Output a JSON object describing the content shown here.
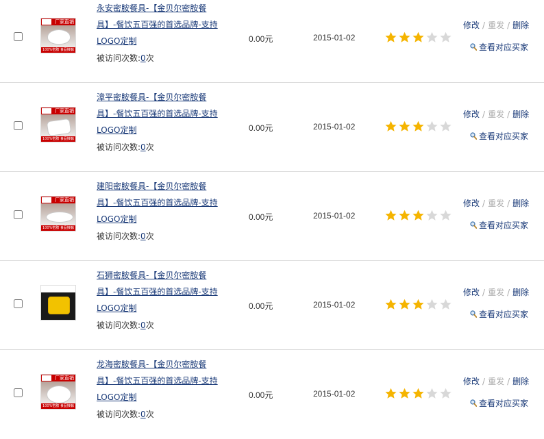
{
  "rows": [
    {
      "title": "永安密胺餐具-【金贝尔密胺餐具】-餐饮五百强的首选品牌-支持LOGO定制",
      "visits_label": "被访问次数:",
      "visits_count": "0",
      "visits_unit": "次",
      "price": "0.00元",
      "date": "2015-01-02",
      "rating": 3,
      "rating_max": 5,
      "thumb_banner": "厂家直销",
      "thumb_footer": "100%密胺 食品接触",
      "edit_label": "修改",
      "resend_label": "重发",
      "delete_label": "删除",
      "buyers_label": "查看对应买家"
    },
    {
      "title": "漳平密胺餐具-【金贝尔密胺餐具】-餐饮五百强的首选品牌-支持LOGO定制",
      "visits_label": "被访问次数:",
      "visits_count": "0",
      "visits_unit": "次",
      "price": "0.00元",
      "date": "2015-01-02",
      "rating": 3,
      "rating_max": 5,
      "thumb_banner": "厂家直销",
      "thumb_footer": "100%密胺 食品接触",
      "edit_label": "修改",
      "resend_label": "重发",
      "delete_label": "删除",
      "buyers_label": "查看对应买家"
    },
    {
      "title": "建阳密胺餐具-【金贝尔密胺餐具】-餐饮五百强的首选品牌-支持LOGO定制",
      "visits_label": "被访问次数:",
      "visits_count": "0",
      "visits_unit": "次",
      "price": "0.00元",
      "date": "2015-01-02",
      "rating": 3,
      "rating_max": 5,
      "thumb_banner": "厂家直销",
      "thumb_footer": "100%密胺 食品接触",
      "edit_label": "修改",
      "resend_label": "重发",
      "delete_label": "删除",
      "buyers_label": "查看对应买家"
    },
    {
      "title": "石狮密胺餐具-【金贝尔密胺餐具】-餐饮五百强的首选品牌-支持LOGO定制",
      "visits_label": "被访问次数:",
      "visits_count": "0",
      "visits_unit": "次",
      "price": "0.00元",
      "date": "2015-01-02",
      "rating": 3,
      "rating_max": 5,
      "thumb_banner": "",
      "thumb_footer": "",
      "edit_label": "修改",
      "resend_label": "重发",
      "delete_label": "删除",
      "buyers_label": "查看对应买家"
    },
    {
      "title": "龙海密胺餐具-【金贝尔密胺餐具】-餐饮五百强的首选品牌-支持LOGO定制",
      "visits_label": "被访问次数:",
      "visits_count": "0",
      "visits_unit": "次",
      "price": "0.00元",
      "date": "2015-01-02",
      "rating": 3,
      "rating_max": 5,
      "thumb_banner": "厂家直销",
      "thumb_footer": "100%密胺 食品接触",
      "edit_label": "修改",
      "resend_label": "重发",
      "delete_label": "删除",
      "buyers_label": "查看对应买家"
    }
  ],
  "colors": {
    "link": "#1a3a78",
    "star_filled": "#f5b400",
    "star_empty": "#d8d8d8",
    "disabled": "#aaaaaa",
    "divider": "#dcdcdc"
  },
  "icons": {
    "star": "star-icon",
    "buyers": "magnifier-icon"
  }
}
